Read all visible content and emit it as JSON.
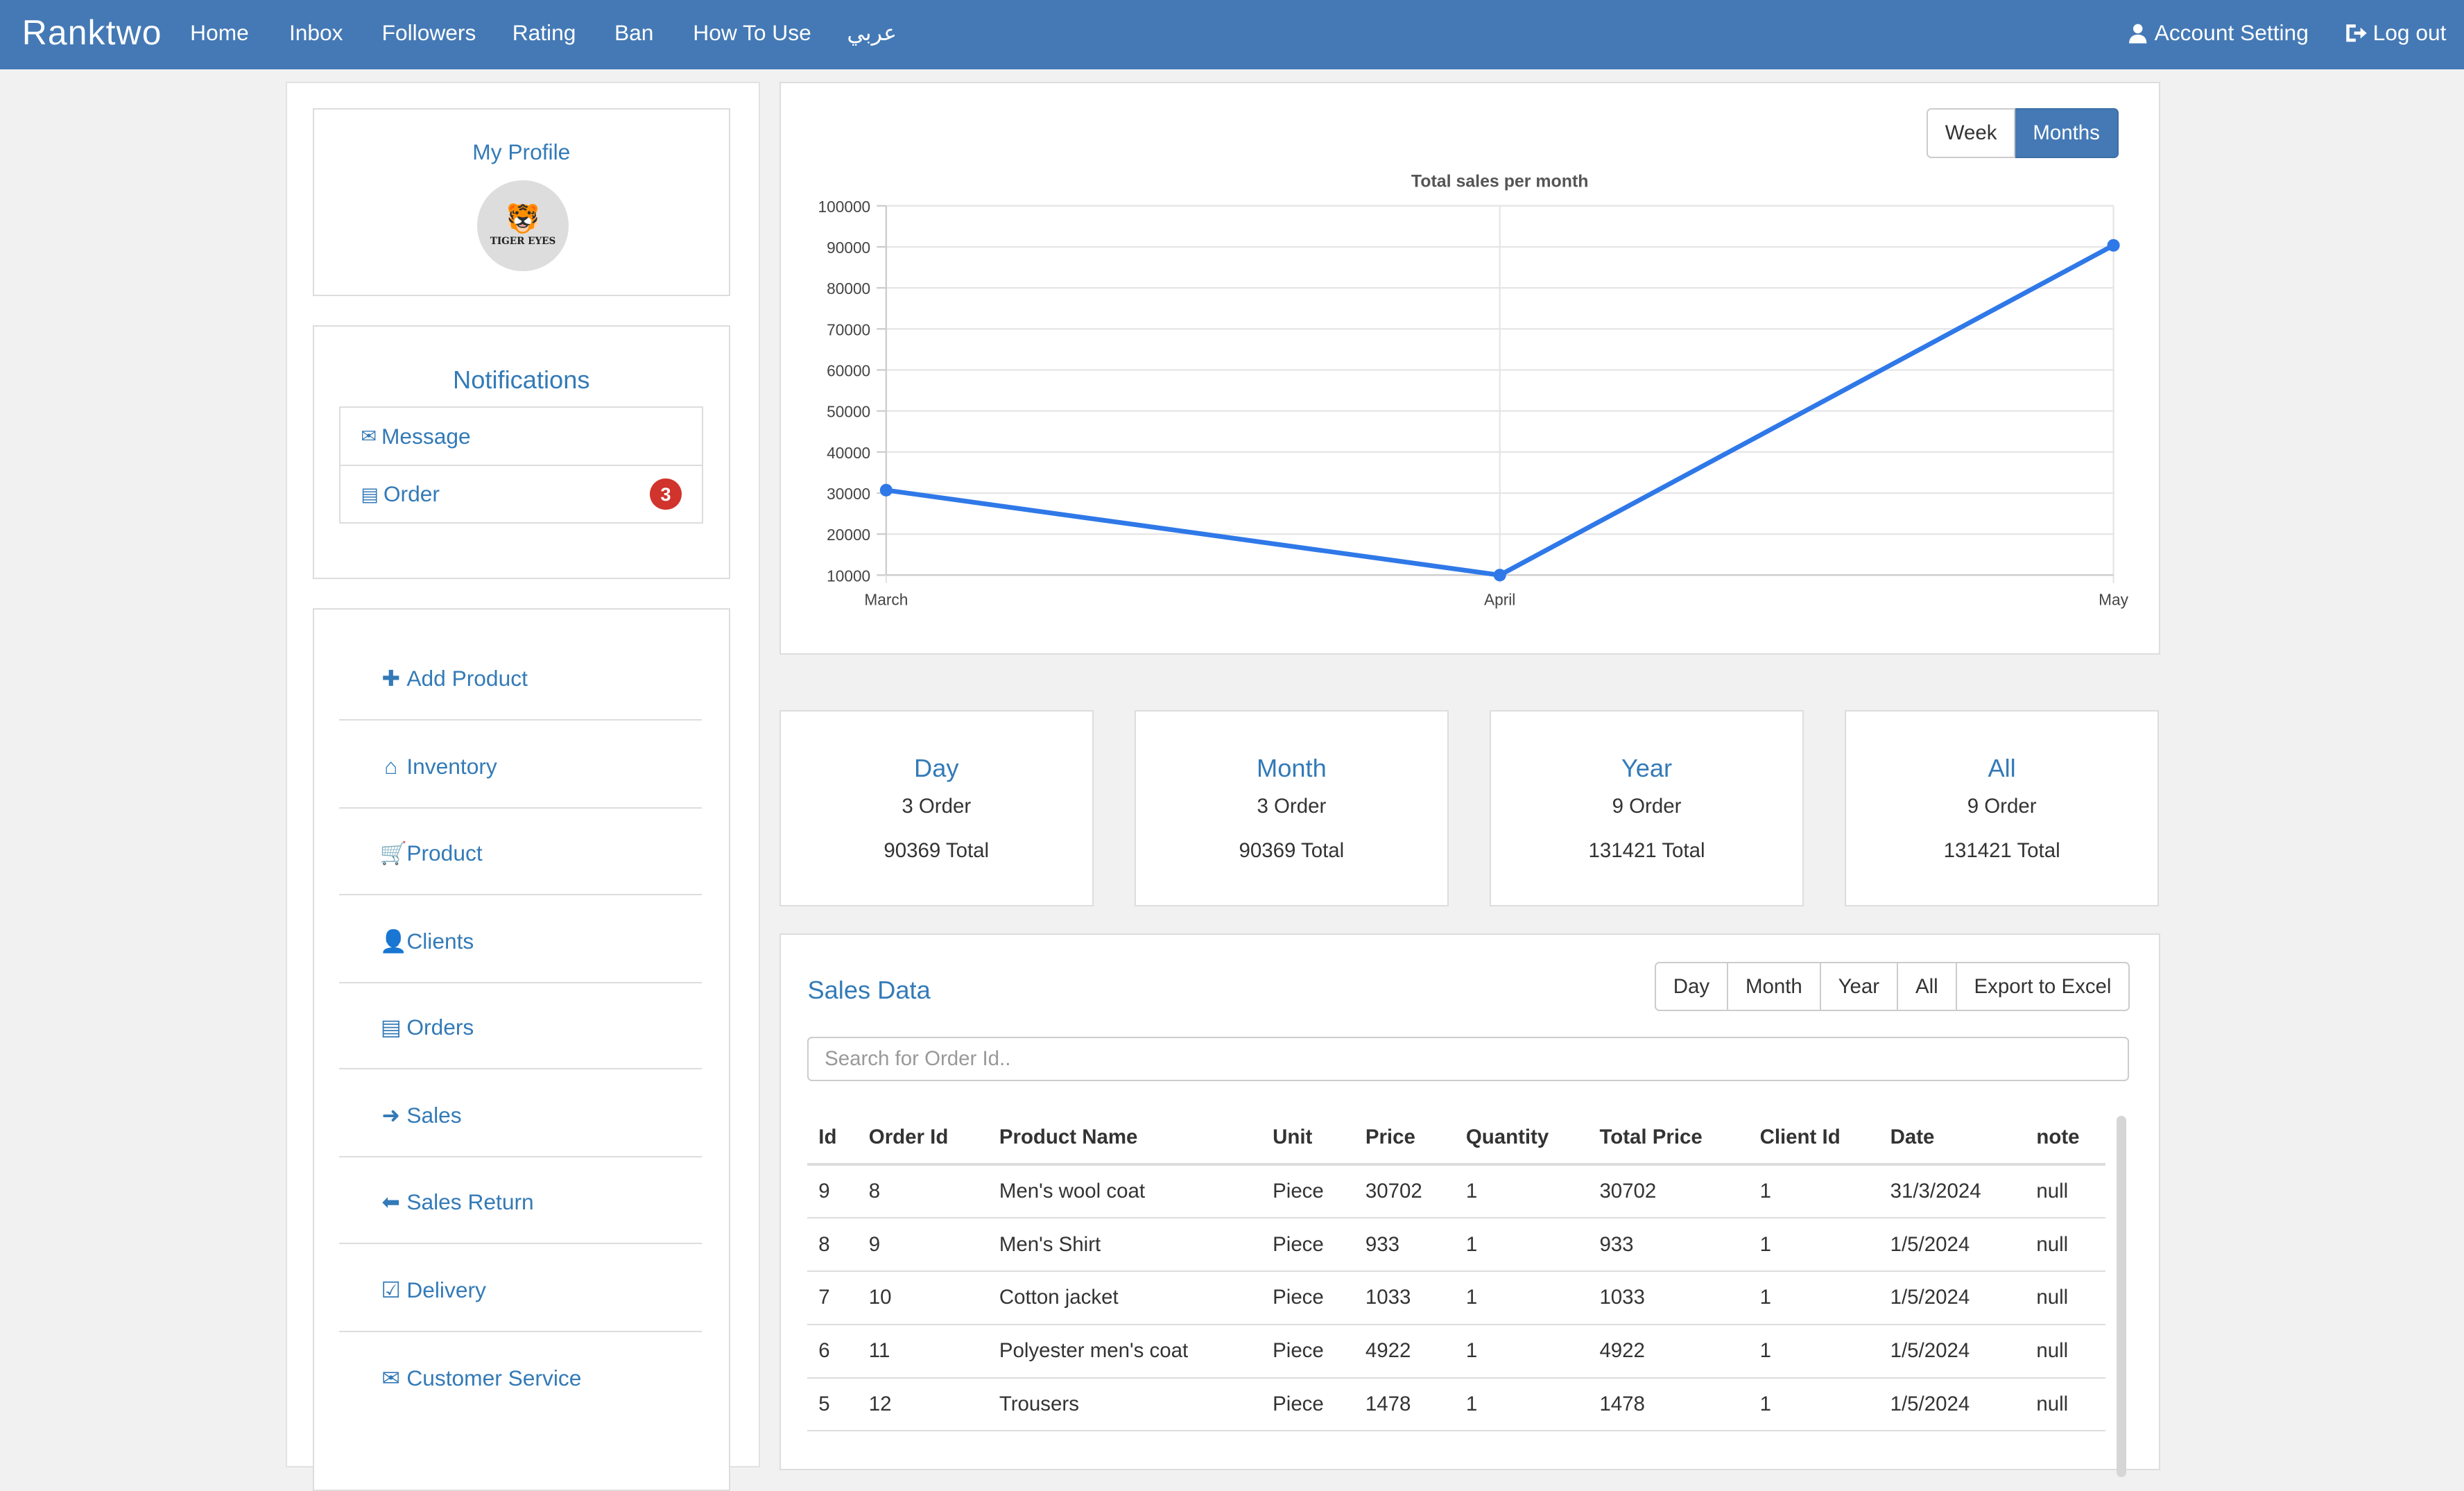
{
  "navbar": {
    "brand": "Ranktwo",
    "items": [
      "Home",
      "Inbox",
      "Followers",
      "Rating",
      "Ban",
      "How To Use",
      "عربي"
    ],
    "account": "Account Setting",
    "logout": "Log out"
  },
  "profile": {
    "title": "My Profile",
    "logo_text": "TIGER EYES"
  },
  "notifications": {
    "title": "Notifications",
    "message": "Message",
    "order": "Order",
    "order_count": "3"
  },
  "menu": [
    {
      "label": "Add Product",
      "icon": "plus-icon"
    },
    {
      "label": "Inventory",
      "icon": "home-icon"
    },
    {
      "label": "Product",
      "icon": "cart-icon"
    },
    {
      "label": "Clients",
      "icon": "user-icon"
    },
    {
      "label": "Orders",
      "icon": "list-icon"
    },
    {
      "label": "Sales",
      "icon": "arrow-right-icon"
    },
    {
      "label": "Sales Return",
      "icon": "arrow-left-icon"
    },
    {
      "label": "Delivery",
      "icon": "check-icon"
    },
    {
      "label": "Customer Service",
      "icon": "envelope-icon"
    }
  ],
  "chart_toggle": {
    "week": "Week",
    "months": "Months",
    "active": "Months"
  },
  "chart_data": {
    "type": "line",
    "title": "Total sales per month",
    "categories": [
      "March",
      "April",
      "May"
    ],
    "series": [
      {
        "values": [
          30702,
          10000,
          90369
        ]
      }
    ],
    "ylim": [
      10000,
      100000
    ],
    "yticks": [
      "100000",
      "90000",
      "80000",
      "70000",
      "60000",
      "50000",
      "40000",
      "30000",
      "20000",
      "10000"
    ],
    "grid": true,
    "color": "#2f78e8"
  },
  "stats": [
    {
      "title": "Day",
      "orders": "3 Order",
      "total": "90369 Total"
    },
    {
      "title": "Month",
      "orders": "3 Order",
      "total": "90369 Total"
    },
    {
      "title": "Year",
      "orders": "9 Order",
      "total": "131421 Total"
    },
    {
      "title": "All",
      "orders": "9 Order",
      "total": "131421 Total"
    }
  ],
  "sales": {
    "title": "Sales Data",
    "filters": [
      "Day",
      "Month",
      "Year",
      "All",
      "Export to Excel"
    ],
    "search_placeholder": "Search for Order Id..",
    "columns": [
      "Id",
      "Order Id",
      "Product Name",
      "Unit",
      "Price",
      "Quantity",
      "Total Price",
      "Client Id",
      "Date",
      "note"
    ],
    "rows": [
      [
        "9",
        "8",
        "Men's wool coat",
        "Piece",
        "30702",
        "1",
        "30702",
        "1",
        "31/3/2024",
        "null"
      ],
      [
        "8",
        "9",
        "Men's Shirt",
        "Piece",
        "933",
        "1",
        "933",
        "1",
        "1/5/2024",
        "null"
      ],
      [
        "7",
        "10",
        "Cotton jacket",
        "Piece",
        "1033",
        "1",
        "1033",
        "1",
        "1/5/2024",
        "null"
      ],
      [
        "6",
        "11",
        "Polyester men's coat",
        "Piece",
        "4922",
        "1",
        "4922",
        "1",
        "1/5/2024",
        "null"
      ],
      [
        "5",
        "12",
        "Trousers",
        "Piece",
        "1478",
        "1",
        "1478",
        "1",
        "1/5/2024",
        "null"
      ]
    ]
  }
}
